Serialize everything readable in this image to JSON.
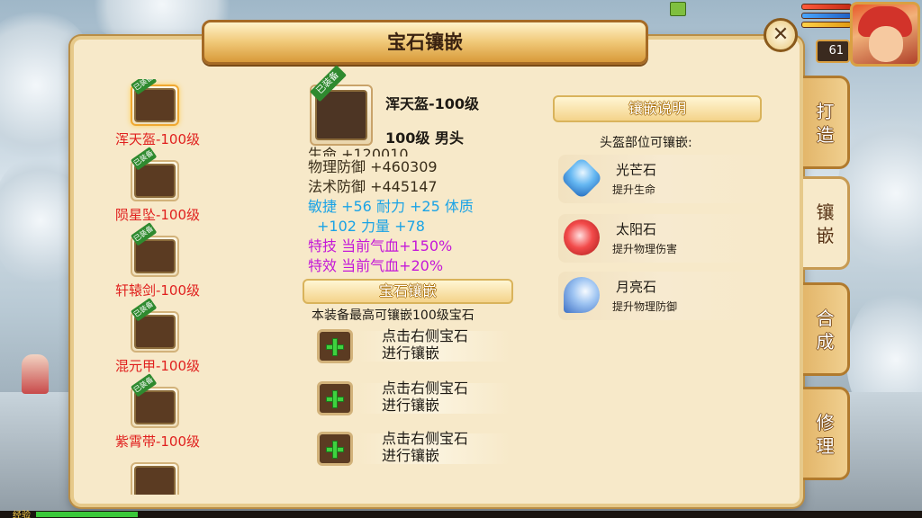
{
  "window": {
    "title": "宝石镶嵌"
  },
  "player": {
    "level": "61"
  },
  "equipment_list": [
    {
      "name": "浑天盔-100级",
      "tag": "已装备"
    },
    {
      "name": "陨星坠-100级",
      "tag": "已装备"
    },
    {
      "name": "轩辕剑-100级",
      "tag": "已装备"
    },
    {
      "name": "混元甲-100级",
      "tag": "已装备"
    },
    {
      "name": "紫霄带-100级",
      "tag": "已装备"
    }
  ],
  "detail": {
    "tag": "已装备",
    "name": "浑天盔-100级",
    "subtitle": "100级  男头",
    "cut_stat": "生命  +120010",
    "stats": [
      "物理防御  +460309",
      "法术防御  +445147"
    ],
    "attr_line1": "敏捷 +56 耐力 +25 体质",
    "attr_line2": "+102 力量 +78",
    "special1": "特技 当前气血+150%",
    "special2": "特效 当前气血+20%"
  },
  "socket_section": {
    "title": "宝石镶嵌",
    "note": "本装备最高可镶嵌100级宝石",
    "slots": [
      {
        "line1": "点击右侧宝石",
        "line2": "进行镶嵌"
      },
      {
        "line1": "点击右侧宝石",
        "line2": "进行镶嵌"
      },
      {
        "line1": "点击右侧宝石",
        "line2": "进行镶嵌"
      }
    ]
  },
  "gem_panel": {
    "title": "镶嵌说明",
    "caption": "头盔部位可镶嵌:",
    "gems": [
      {
        "name": "光芒石",
        "desc": "提升生命",
        "icon": "light-gem-icon"
      },
      {
        "name": "太阳石",
        "desc": "提升物理伤害",
        "icon": "sun-gem-icon"
      },
      {
        "name": "月亮石",
        "desc": "提升物理防御",
        "icon": "moon-gem-icon"
      }
    ]
  },
  "tabs": [
    {
      "label1": "打",
      "label2": "造"
    },
    {
      "label1": "镶",
      "label2": "嵌"
    },
    {
      "label1": "合",
      "label2": "成"
    },
    {
      "label1": "修",
      "label2": "理"
    }
  ],
  "exp": {
    "label": "经验",
    "progress": 0.11
  },
  "colors": {
    "item_name": "#e0201e",
    "blue_stat": "#1aa3e6",
    "purple_stat": "#c418d8",
    "panel": "#f7e9c9"
  }
}
